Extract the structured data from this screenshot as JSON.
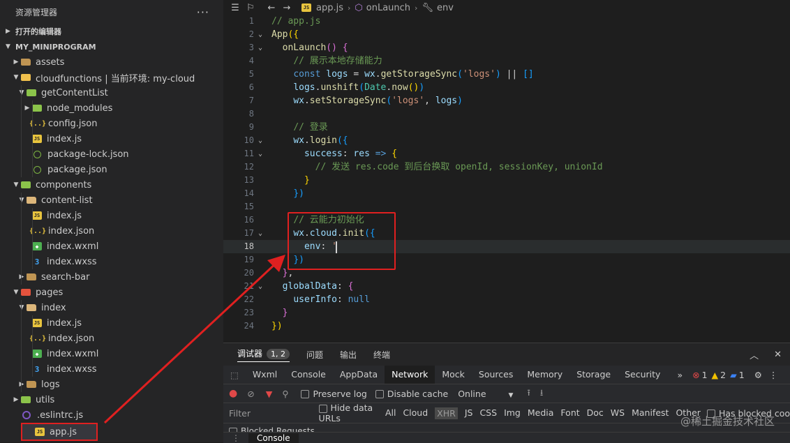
{
  "explorer": {
    "title": "资源管理器",
    "more": "···",
    "open_editors": "打开的编辑器",
    "project": "MY_MINIPROGRAM",
    "items": [
      {
        "label": "assets",
        "level": 1,
        "chevron": "closed",
        "icon": "folder"
      },
      {
        "label": "cloudfunctions | 当前环境: my-cloud",
        "level": 1,
        "chevron": "open",
        "icon": "folder-cloud"
      },
      {
        "label": "getContentList",
        "level": 2,
        "chevron": "open",
        "icon": "folder-green"
      },
      {
        "label": "node_modules",
        "level": 3,
        "chevron": "closed",
        "icon": "folder-green"
      },
      {
        "label": "config.json",
        "level": 3,
        "chevron": "none",
        "icon": "json"
      },
      {
        "label": "index.js",
        "level": 3,
        "chevron": "none",
        "icon": "js"
      },
      {
        "label": "package-lock.json",
        "level": 3,
        "chevron": "none",
        "icon": "pkg"
      },
      {
        "label": "package.json",
        "level": 3,
        "chevron": "none",
        "icon": "pkg"
      },
      {
        "label": "components",
        "level": 1,
        "chevron": "open",
        "icon": "folder-green"
      },
      {
        "label": "content-list",
        "level": 2,
        "chevron": "open",
        "icon": "folder-open"
      },
      {
        "label": "index.js",
        "level": 3,
        "chevron": "none",
        "icon": "js"
      },
      {
        "label": "index.json",
        "level": 3,
        "chevron": "none",
        "icon": "json"
      },
      {
        "label": "index.wxml",
        "level": 3,
        "chevron": "none",
        "icon": "wxml"
      },
      {
        "label": "index.wxss",
        "level": 3,
        "chevron": "none",
        "icon": "wxss"
      },
      {
        "label": "search-bar",
        "level": 2,
        "chevron": "closed",
        "icon": "folder"
      },
      {
        "label": "pages",
        "level": 1,
        "chevron": "open",
        "icon": "folder-red"
      },
      {
        "label": "index",
        "level": 2,
        "chevron": "open",
        "icon": "folder-open"
      },
      {
        "label": "index.js",
        "level": 3,
        "chevron": "none",
        "icon": "js"
      },
      {
        "label": "index.json",
        "level": 3,
        "chevron": "none",
        "icon": "json"
      },
      {
        "label": "index.wxml",
        "level": 3,
        "chevron": "none",
        "icon": "wxml"
      },
      {
        "label": "index.wxss",
        "level": 3,
        "chevron": "none",
        "icon": "wxss"
      },
      {
        "label": "logs",
        "level": 2,
        "chevron": "closed",
        "icon": "folder"
      },
      {
        "label": "utils",
        "level": 1,
        "chevron": "closed",
        "icon": "folder-green"
      },
      {
        "label": ".eslintrc.js",
        "level": 1,
        "chevron": "none",
        "icon": "eslint"
      },
      {
        "label": "app.js",
        "level": 1,
        "chevron": "none",
        "icon": "js",
        "selected": true
      }
    ]
  },
  "breadcrumb": {
    "file": "app.js",
    "method": "onLaunch",
    "prop": "env"
  },
  "editor": {
    "current_line": 18,
    "lines": [
      {
        "n": "1",
        "fold": "",
        "tokens": [
          [
            "cm",
            "// app.js"
          ]
        ]
      },
      {
        "n": "2",
        "fold": "v",
        "tokens": [
          [
            "fn",
            "App"
          ],
          [
            "br1",
            "({"
          ]
        ]
      },
      {
        "n": "3",
        "fold": "v",
        "tokens": [
          [
            "",
            "  "
          ],
          [
            "fn",
            "onLaunch"
          ],
          [
            "br2",
            "()"
          ],
          [
            "",
            " "
          ],
          [
            "br2",
            "{"
          ]
        ]
      },
      {
        "n": "4",
        "fold": "",
        "tokens": [
          [
            "",
            "    "
          ],
          [
            "cm",
            "// 展示本地存储能力"
          ]
        ]
      },
      {
        "n": "5",
        "fold": "",
        "tokens": [
          [
            "",
            "    "
          ],
          [
            "kw",
            "const"
          ],
          [
            "",
            " "
          ],
          [
            "pr",
            "logs"
          ],
          [
            "",
            " = "
          ],
          [
            "pr",
            "wx"
          ],
          [
            "",
            "."
          ],
          [
            "fn",
            "getStorageSync"
          ],
          [
            "br3",
            "("
          ],
          [
            "str",
            "'logs'"
          ],
          [
            "br3",
            ")"
          ],
          [
            "",
            " || "
          ],
          [
            "br3",
            "[]"
          ]
        ]
      },
      {
        "n": "6",
        "fold": "",
        "tokens": [
          [
            "",
            "    "
          ],
          [
            "pr",
            "logs"
          ],
          [
            "",
            "."
          ],
          [
            "fn",
            "unshift"
          ],
          [
            "br3",
            "("
          ],
          [
            "ty",
            "Date"
          ],
          [
            "",
            "."
          ],
          [
            "fn",
            "now"
          ],
          [
            "br1",
            "()"
          ],
          [
            "br3",
            ")"
          ]
        ]
      },
      {
        "n": "7",
        "fold": "",
        "tokens": [
          [
            "",
            "    "
          ],
          [
            "pr",
            "wx"
          ],
          [
            "",
            "."
          ],
          [
            "fn",
            "setStorageSync"
          ],
          [
            "br3",
            "("
          ],
          [
            "str",
            "'logs'"
          ],
          [
            "",
            ", "
          ],
          [
            "pr",
            "logs"
          ],
          [
            "br3",
            ")"
          ]
        ]
      },
      {
        "n": "8",
        "fold": "",
        "tokens": []
      },
      {
        "n": "9",
        "fold": "",
        "tokens": [
          [
            "",
            "    "
          ],
          [
            "cm",
            "// 登录"
          ]
        ]
      },
      {
        "n": "10",
        "fold": "v",
        "tokens": [
          [
            "",
            "    "
          ],
          [
            "pr",
            "wx"
          ],
          [
            "",
            "."
          ],
          [
            "fn",
            "login"
          ],
          [
            "br3",
            "({"
          ]
        ]
      },
      {
        "n": "11",
        "fold": "v",
        "tokens": [
          [
            "",
            "      "
          ],
          [
            "pr",
            "success"
          ],
          [
            "",
            ": "
          ],
          [
            "pr",
            "res"
          ],
          [
            "",
            " "
          ],
          [
            "kw",
            "=>"
          ],
          [
            "",
            " "
          ],
          [
            "br1",
            "{"
          ]
        ]
      },
      {
        "n": "12",
        "fold": "",
        "tokens": [
          [
            "",
            "        "
          ],
          [
            "cm",
            "// 发送 res.code 到后台换取 openId, sessionKey, unionId"
          ]
        ]
      },
      {
        "n": "13",
        "fold": "",
        "tokens": [
          [
            "",
            "      "
          ],
          [
            "br1",
            "}"
          ]
        ]
      },
      {
        "n": "14",
        "fold": "",
        "tokens": [
          [
            "",
            "    "
          ],
          [
            "br3",
            "})"
          ]
        ]
      },
      {
        "n": "15",
        "fold": "",
        "tokens": []
      },
      {
        "n": "16",
        "fold": "",
        "tokens": [
          [
            "",
            "    "
          ],
          [
            "cm",
            "// 云能力初始化"
          ]
        ]
      },
      {
        "n": "17",
        "fold": "v",
        "tokens": [
          [
            "",
            "    "
          ],
          [
            "pr",
            "wx"
          ],
          [
            "",
            "."
          ],
          [
            "pr",
            "cloud"
          ],
          [
            "",
            "."
          ],
          [
            "fn",
            "init"
          ],
          [
            "br3",
            "({"
          ]
        ]
      },
      {
        "n": "18",
        "fold": "",
        "tokens": [
          [
            "",
            "      "
          ],
          [
            "pr",
            "env"
          ],
          [
            "",
            ": "
          ],
          [
            "str",
            "'"
          ]
        ]
      },
      {
        "n": "19",
        "fold": "",
        "tokens": [
          [
            "",
            "    "
          ],
          [
            "br3",
            "})"
          ]
        ]
      },
      {
        "n": "20",
        "fold": "",
        "tokens": [
          [
            "",
            "  "
          ],
          [
            "br2",
            "}"
          ],
          [
            "",
            ","
          ]
        ]
      },
      {
        "n": "21",
        "fold": "v",
        "tokens": [
          [
            "",
            "  "
          ],
          [
            "pr",
            "globalData"
          ],
          [
            "",
            ": "
          ],
          [
            "br2",
            "{"
          ]
        ]
      },
      {
        "n": "22",
        "fold": "",
        "tokens": [
          [
            "",
            "    "
          ],
          [
            "pr",
            "userInfo"
          ],
          [
            "",
            ": "
          ],
          [
            "kw",
            "null"
          ]
        ]
      },
      {
        "n": "23",
        "fold": "",
        "tokens": [
          [
            "",
            "  "
          ],
          [
            "br2",
            "}"
          ]
        ]
      },
      {
        "n": "24",
        "fold": "",
        "tokens": [
          [
            "br1",
            "})"
          ]
        ]
      }
    ]
  },
  "panel": {
    "tabs": [
      {
        "label": "调试器",
        "active": true,
        "badge": "1, 2"
      },
      {
        "label": "问题"
      },
      {
        "label": "输出"
      },
      {
        "label": "终端"
      }
    ],
    "devtools_tabs": [
      "Wxml",
      "Console",
      "AppData",
      "Network",
      "Mock",
      "Sources",
      "Memory",
      "Storage",
      "Security"
    ],
    "devtools_active": "Network",
    "more_tabs": "»",
    "errors": "1",
    "warnings": "2",
    "info": "1",
    "preserve_log": "Preserve log",
    "disable_cache": "Disable cache",
    "throttle": "Online",
    "filter_placeholder": "Filter",
    "hide_data_urls": "Hide data URLs",
    "types": [
      "All",
      "Cloud",
      "XHR",
      "JS",
      "CSS",
      "Img",
      "Media",
      "Font",
      "Doc",
      "WS",
      "Manifest",
      "Other"
    ],
    "types_active": "XHR",
    "has_blocked": "Has blocked coo",
    "blocked_requests": "Blocked Requests",
    "console_tab": "Console"
  },
  "watermark": "@稀土掘金技术社区",
  "colors": {
    "annotation_red": "#e02020",
    "accent_blue": "#007acc"
  }
}
